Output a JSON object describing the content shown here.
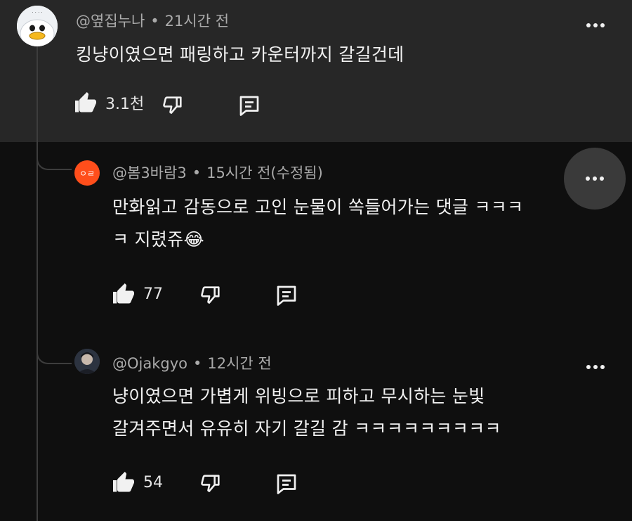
{
  "comments": [
    {
      "author": "@옆집누나",
      "time": "21시간 전",
      "lines": [
        "킹냥이였으면 패링하고 카운터까지 갈길건데"
      ],
      "likes": "3.1천",
      "avatar_icon": "duck-avatar-icon"
    },
    {
      "author": "@봄3바람3",
      "time": "15시간 전(수정됨)",
      "lines": [
        "만화읽고 감동으로 고인 눈물이 쏙들어가는 댓글 ㅋㅋㅋ",
        "ㅋ 지렸쥬😂"
      ],
      "likes": "77",
      "avatar_text": "ㅇㄹ",
      "avatar_color": "#ff4e1b"
    },
    {
      "author": "@Ojakgyo",
      "time": "12시간 전",
      "lines": [
        "냥이였으면 가볍게 위빙으로 피하고 무시하는 눈빛",
        "갈겨주면서 유유히 자기 갈길 감 ㅋㅋㅋㅋㅋㅋㅋㅋㅋ"
      ],
      "likes": "54",
      "avatar_icon": "person-avatar-icon"
    }
  ],
  "separator": "•",
  "colors": {
    "top_bg": "#272727",
    "page_bg": "#0f0f0f",
    "meta_text": "#aaaaaa",
    "more_hover_bg": "#3a3a3a"
  }
}
